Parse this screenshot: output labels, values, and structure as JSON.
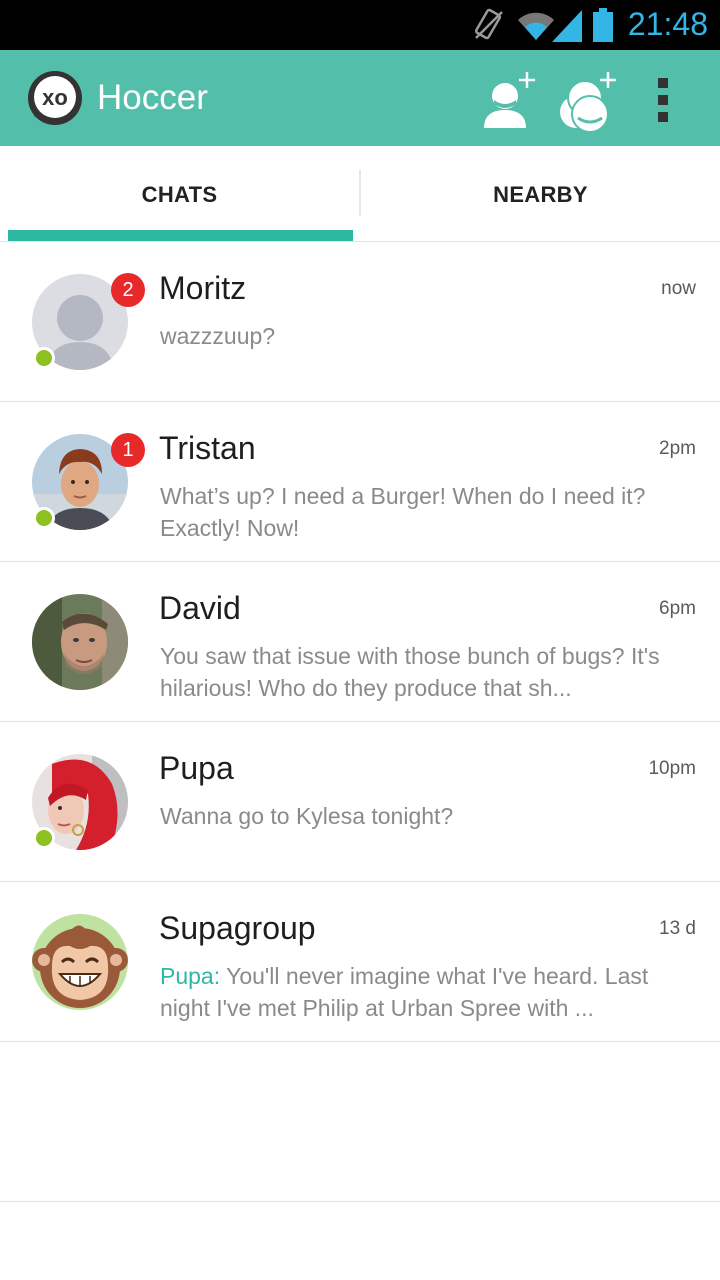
{
  "status_bar": {
    "time": "21:48",
    "icons": [
      "vibrate-icon",
      "wifi-icon",
      "signal-icon",
      "battery-icon"
    ]
  },
  "app_bar": {
    "title": "Hoccer",
    "logo_text": "xo",
    "actions": [
      "add-contact-icon",
      "add-group-icon",
      "overflow-menu-icon"
    ],
    "color": "#53bfab"
  },
  "tabs": [
    {
      "label": "CHATS",
      "selected": true
    },
    {
      "label": "NEARBY",
      "selected": false
    }
  ],
  "chats": [
    {
      "name": "Moritz",
      "time": "now",
      "unread": "2",
      "online": true,
      "sender": "",
      "preview": "wazzzuup?",
      "avatar": "placeholder"
    },
    {
      "name": "Tristan",
      "time": "2pm",
      "unread": "1",
      "online": true,
      "sender": "",
      "preview": "What’s up? I need a Burger! When do I need it? Exactly! Now!",
      "avatar": "photo"
    },
    {
      "name": "David",
      "time": "6pm",
      "unread": "",
      "online": false,
      "sender": "",
      "preview": "You saw that issue with those bunch of bugs? It's hilarious! Who do they produce that sh...",
      "avatar": "photo"
    },
    {
      "name": "Pupa",
      "time": "10pm",
      "unread": "",
      "online": true,
      "sender": "",
      "preview": "Wanna go to Kylesa tonight?",
      "avatar": "photo"
    },
    {
      "name": "Supagroup",
      "time": "13 d",
      "unread": "",
      "online": false,
      "sender": "Pupa:",
      "preview": " You'll never imagine what I've heard. Last night I've met Philip at Urban Spree with ...",
      "avatar": "monkey"
    }
  ],
  "colors": {
    "accent": "#2db8a4",
    "badge": "#e8292a",
    "online": "#8dc11f"
  }
}
